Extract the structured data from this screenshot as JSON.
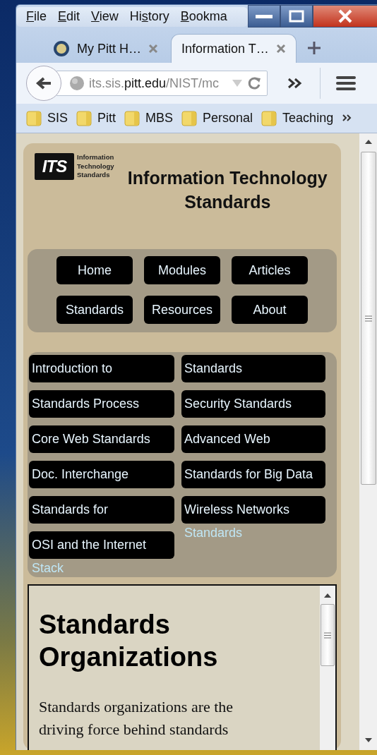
{
  "menu": [
    {
      "key": "F",
      "post": "ile"
    },
    {
      "key": "E",
      "post": "dit"
    },
    {
      "key": "V",
      "post": "iew"
    },
    {
      "pre": "Hi",
      "key": "s",
      "post": "tory"
    },
    {
      "key": "B",
      "post": "ookma"
    }
  ],
  "tabs": [
    {
      "title": "My Pitt H…",
      "selected": false
    },
    {
      "title": "Information T…",
      "selected": true
    }
  ],
  "url": {
    "prefix": "its.sis.",
    "domain": "pitt.edu",
    "path": "/NIST/mc"
  },
  "bookmarks": [
    "SIS",
    "Pitt",
    "MBS",
    "Personal",
    "Teaching"
  ],
  "site": {
    "logo_mark": "ITS",
    "logo_text": [
      "Information",
      "Technology",
      "Standards"
    ],
    "title": "Information Technology Standards"
  },
  "nav": [
    "Home",
    "Modules",
    "Articles",
    "Standards",
    "Resources",
    "About"
  ],
  "modules": [
    {
      "label": "Introduction to"
    },
    {
      "label": "Standards"
    },
    {
      "label": "Standards Process"
    },
    {
      "label": "Security Standards"
    },
    {
      "label": "Core Web Standards"
    },
    {
      "label": "Advanced Web"
    },
    {
      "label": "Doc. Interchange"
    },
    {
      "label": "Standards for Big Data"
    },
    {
      "label": "Standards for"
    },
    {
      "label": "Wireless Networks",
      "continuation": "Standards"
    },
    {
      "label": "OSI and the Internet",
      "continuation": "Stack"
    }
  ],
  "article": {
    "heading": "Standards Organizations",
    "paragraph": "Standards organizations are the driving force behind standards"
  }
}
